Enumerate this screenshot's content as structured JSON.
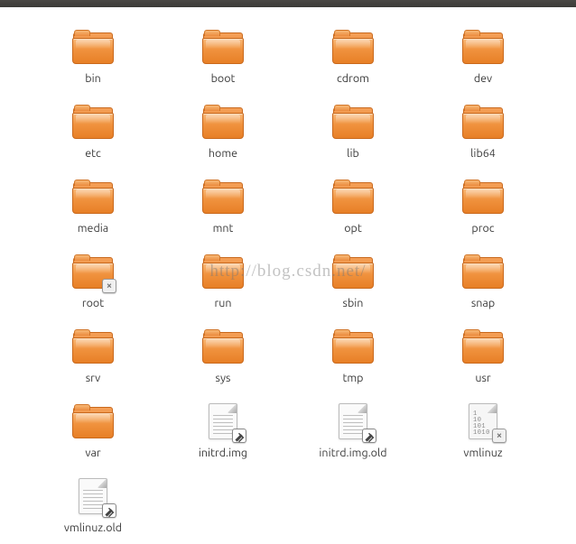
{
  "watermark": "http://blog.csdn.net/",
  "items": [
    {
      "name": "bin",
      "type": "folder"
    },
    {
      "name": "boot",
      "type": "folder"
    },
    {
      "name": "cdrom",
      "type": "folder"
    },
    {
      "name": "dev",
      "type": "folder"
    },
    {
      "name": "etc",
      "type": "folder"
    },
    {
      "name": "home",
      "type": "folder"
    },
    {
      "name": "lib",
      "type": "folder"
    },
    {
      "name": "lib64",
      "type": "folder"
    },
    {
      "name": "media",
      "type": "folder"
    },
    {
      "name": "mnt",
      "type": "folder"
    },
    {
      "name": "opt",
      "type": "folder"
    },
    {
      "name": "proc",
      "type": "folder"
    },
    {
      "name": "root",
      "type": "folder",
      "emblem": "noaccess"
    },
    {
      "name": "run",
      "type": "folder"
    },
    {
      "name": "sbin",
      "type": "folder"
    },
    {
      "name": "snap",
      "type": "folder"
    },
    {
      "name": "srv",
      "type": "folder"
    },
    {
      "name": "sys",
      "type": "folder"
    },
    {
      "name": "tmp",
      "type": "folder"
    },
    {
      "name": "usr",
      "type": "folder"
    },
    {
      "name": "var",
      "type": "folder"
    },
    {
      "name": "initrd.img",
      "type": "textfile",
      "emblem": "link"
    },
    {
      "name": "initrd.img.old",
      "type": "textfile",
      "emblem": "link"
    },
    {
      "name": "vmlinuz",
      "type": "binfile",
      "emblem": "noaccess"
    },
    {
      "name": "vmlinuz.old",
      "type": "textfile",
      "emblem": "link"
    }
  ],
  "colors": {
    "folder_accent": "#ee8635"
  }
}
